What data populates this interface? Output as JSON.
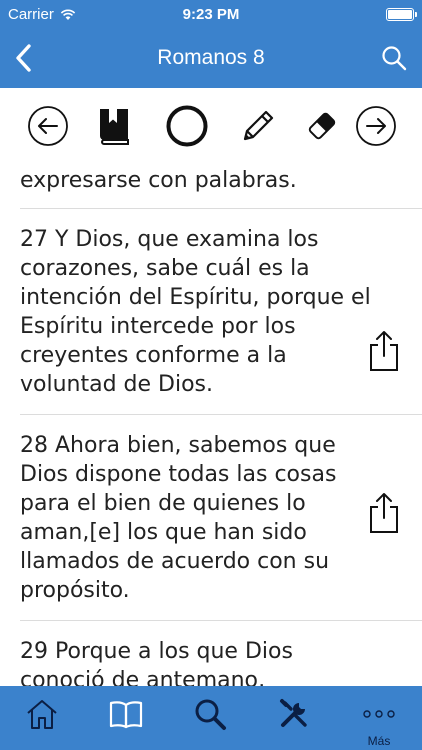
{
  "status": {
    "carrier": "Carrier",
    "time": "9:23 PM"
  },
  "nav": {
    "title": "Romanos 8"
  },
  "toolbar": {
    "items": [
      "arrow-left-circle-icon",
      "bookmark-book-icon",
      "circle-icon",
      "pencil-icon",
      "eraser-icon",
      "arrow-right-circle-icon"
    ]
  },
  "verses": [
    {
      "text": "expresarse con palabras."
    },
    {
      "text": "27 Y Dios, que examina los corazones, sabe cuál es la intención del Espíritu, porque el Espíritu intercede por los creyentes conforme a la voluntad de Dios."
    },
    {
      "text": "28 Ahora bien, sabemos que Dios dispone todas las cosas para el bien de quienes lo aman,[e] los que han sido llamados de acuerdo con su propósito."
    },
    {
      "text": "29 Porque a los que Dios conoció de antemano,"
    }
  ],
  "tabbar": {
    "items": [
      "home-icon",
      "book-icon",
      "search-icon",
      "tools-icon",
      "more-icon"
    ],
    "more_label": "Más"
  },
  "colors": {
    "accent": "#3b82cc",
    "tab_icon": "#0b1f44"
  }
}
